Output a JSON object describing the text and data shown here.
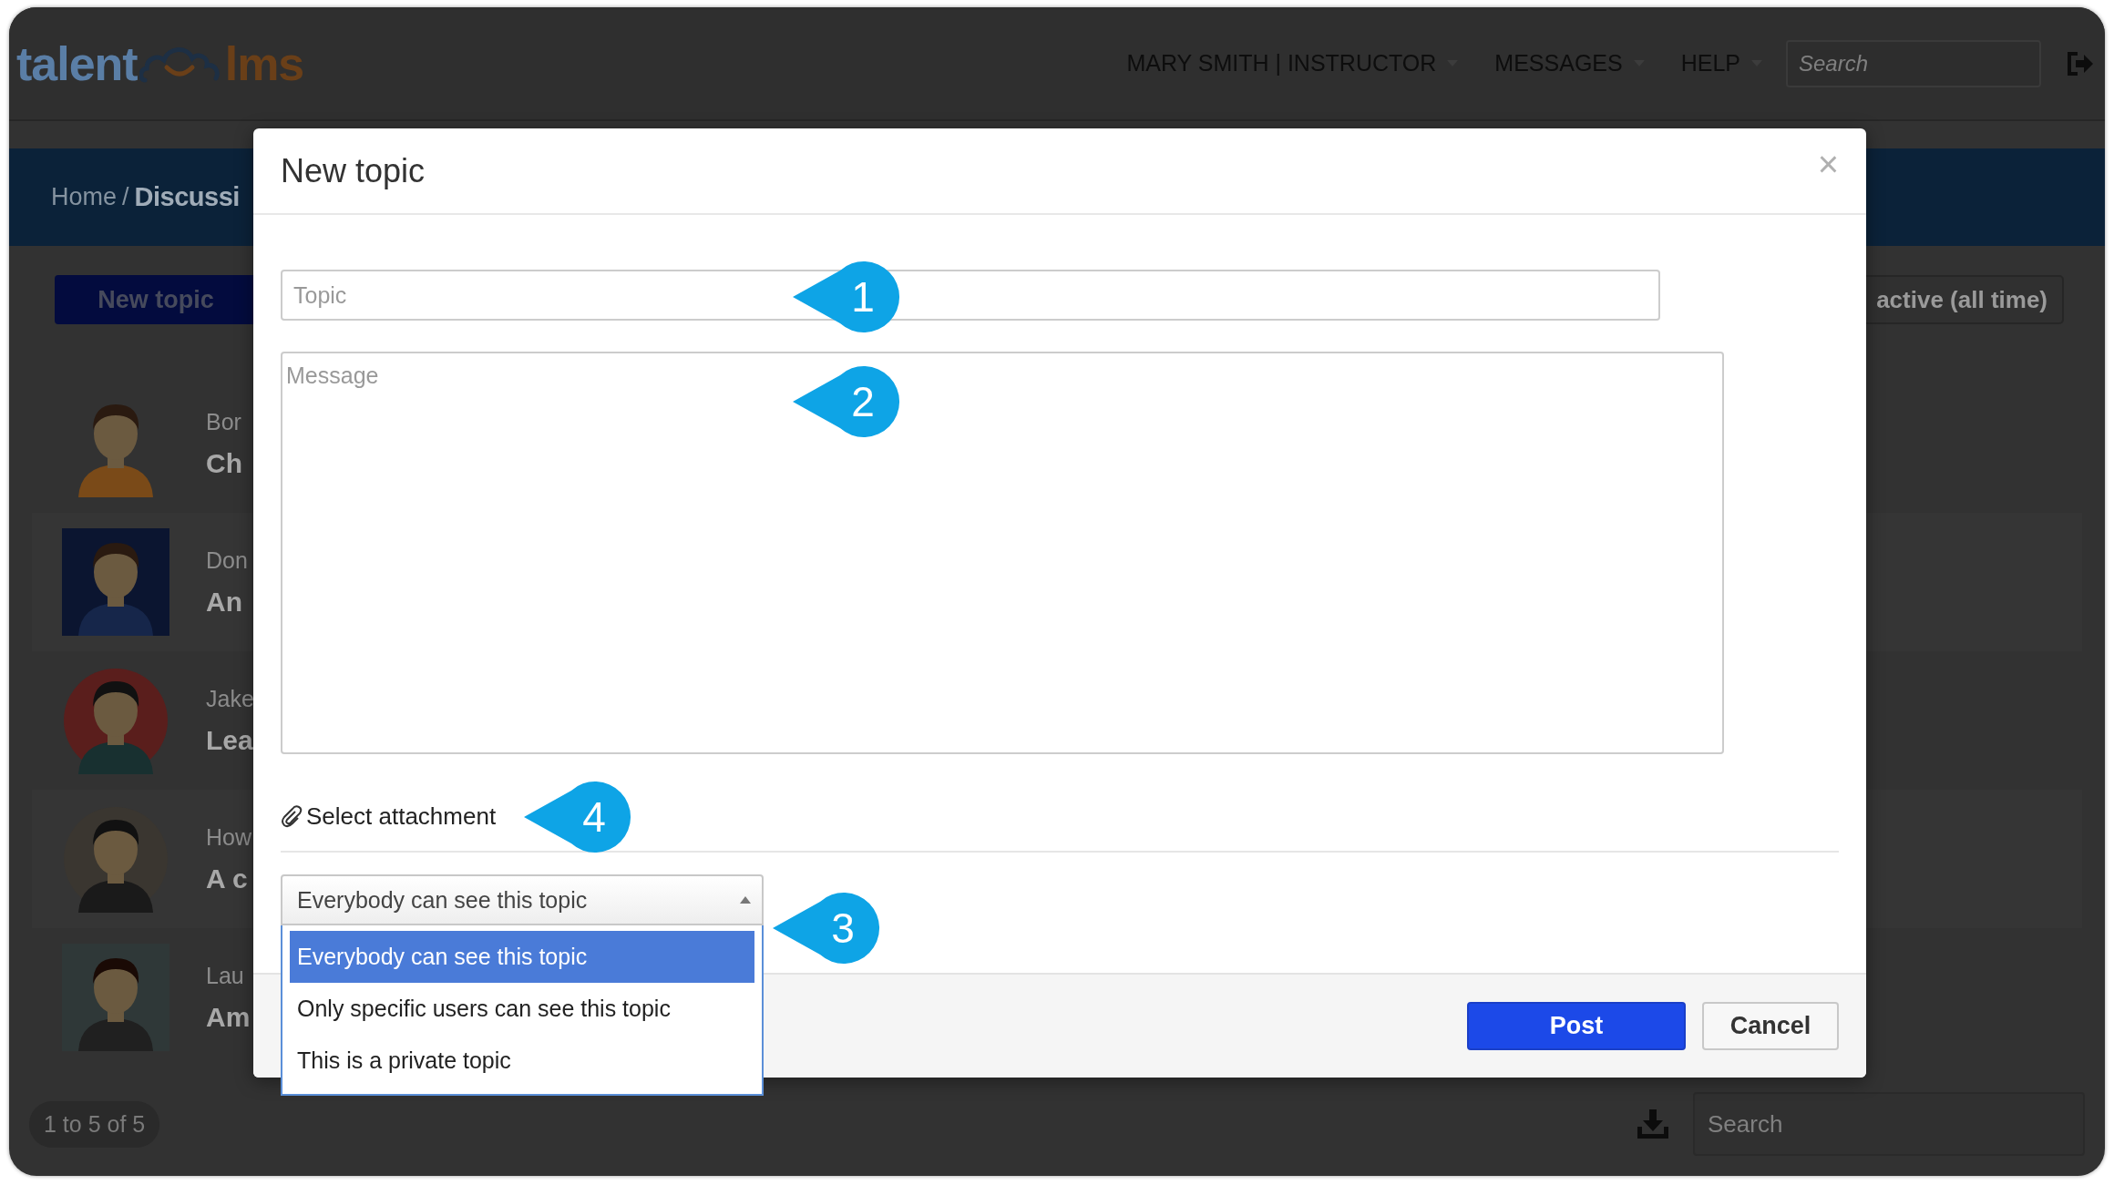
{
  "topbar": {
    "logo": {
      "part_1": "talent",
      "part_2": "lms"
    },
    "nav": [
      {
        "label": "MARY SMITH | INSTRUCTOR"
      },
      {
        "label": "MESSAGES"
      },
      {
        "label": "HELP"
      }
    ],
    "search": {
      "placeholder": "Search"
    }
  },
  "breadcrumb": {
    "home": "Home",
    "separator": "/",
    "current": "Discussi"
  },
  "new_topic_button": "New topic",
  "filter_button": "active (all time)",
  "discussions": [
    {
      "author": "Bor",
      "title": "Ch"
    },
    {
      "author": "Don",
      "title": "An"
    },
    {
      "author": "Jake",
      "title": "Lea"
    },
    {
      "author": "How",
      "title": "A c"
    },
    {
      "author": "Lau",
      "title": "Am"
    }
  ],
  "pagination": "1 to 5 of 5",
  "bottom_search": {
    "placeholder": "Search"
  },
  "modal": {
    "title": "New topic",
    "close": "×",
    "topic": {
      "placeholder": "Topic"
    },
    "message": {
      "placeholder": "Message"
    },
    "attachment": "Select attachment",
    "visibility": {
      "value": "Everybody can see this topic",
      "expanded": true,
      "options": [
        {
          "label": "Everybody can see this topic",
          "selected": true
        },
        {
          "label": "Only specific users can see this topic",
          "selected": false
        },
        {
          "label": "This is a private topic",
          "selected": false
        }
      ]
    },
    "buttons": [
      {
        "label": "Post",
        "kind": "primary"
      },
      {
        "label": "Cancel",
        "kind": "secondary"
      }
    ]
  },
  "callouts": [
    {
      "number": "1"
    },
    {
      "number": "2"
    },
    {
      "number": "4"
    },
    {
      "number": "3"
    }
  ]
}
